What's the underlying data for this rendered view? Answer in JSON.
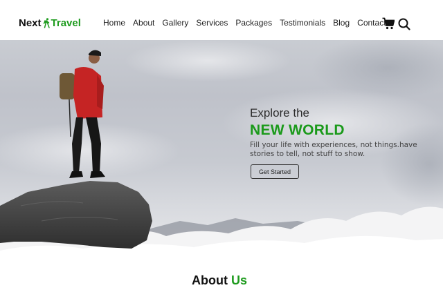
{
  "brand": {
    "part1": "Next",
    "part2": "Travel",
    "accent_color": "#1e9b1e"
  },
  "nav": {
    "items": [
      {
        "label": "Home"
      },
      {
        "label": "About"
      },
      {
        "label": "Gallery"
      },
      {
        "label": "Services"
      },
      {
        "label": "Packages"
      },
      {
        "label": "Testimonials"
      },
      {
        "label": "Blog"
      },
      {
        "label": "Contact"
      }
    ],
    "icons": [
      "cart-icon",
      "search-icon"
    ]
  },
  "hero": {
    "kicker": "Explore the",
    "title": "NEW WORLD",
    "description": "Fill your life with experiences, not things.have stories to tell, not stuff to show.",
    "cta_label": "Get Started"
  },
  "about": {
    "title_part1": "About",
    "title_part2": "Us"
  }
}
